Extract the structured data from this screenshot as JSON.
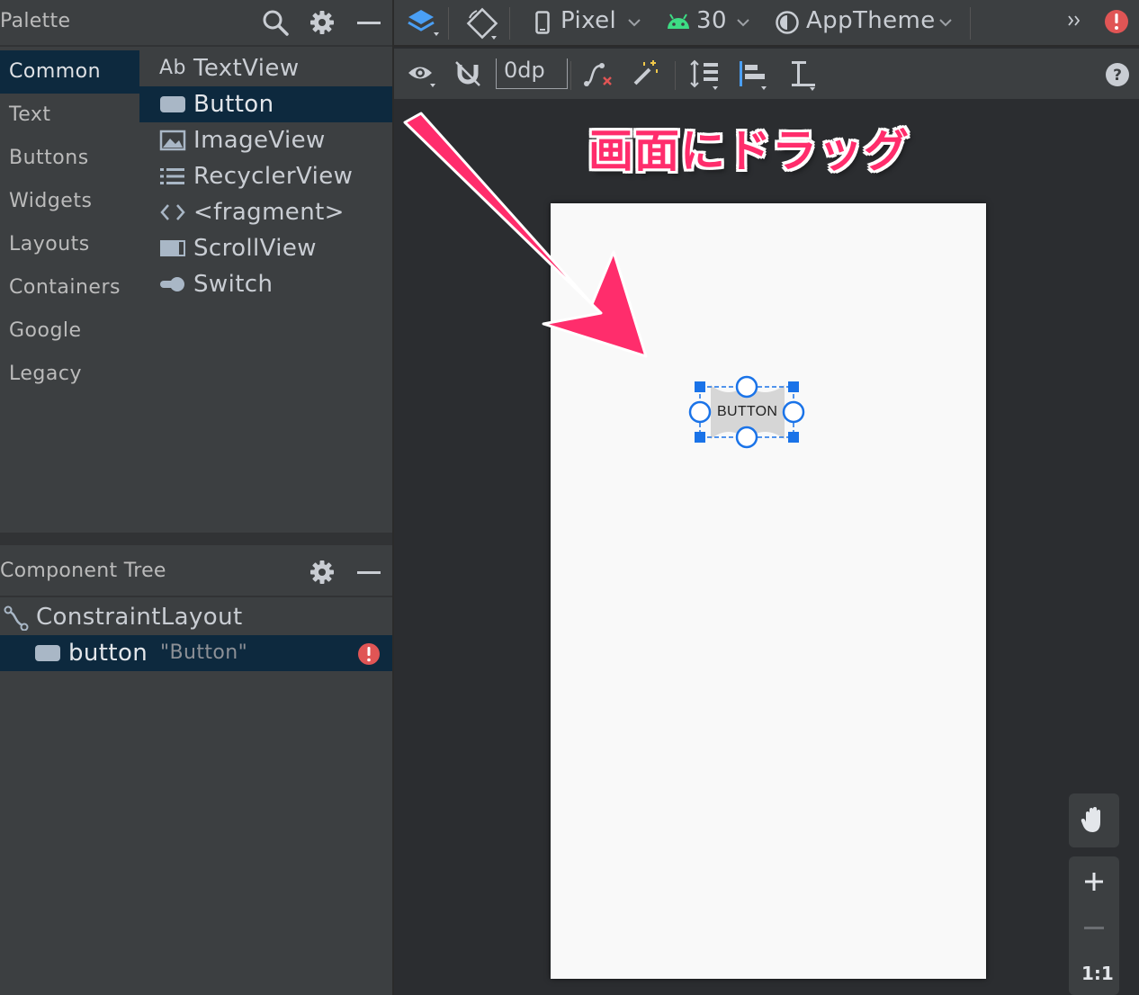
{
  "palette": {
    "title": "Palette",
    "categories": [
      "Common",
      "Text",
      "Buttons",
      "Widgets",
      "Layouts",
      "Containers",
      "Google",
      "Legacy"
    ],
    "selected_category": "Common",
    "items": [
      {
        "label": "TextView",
        "icon": "textview-icon"
      },
      {
        "label": "Button",
        "icon": "button-widget-icon"
      },
      {
        "label": "ImageView",
        "icon": "image-icon"
      },
      {
        "label": "RecyclerView",
        "icon": "list-icon"
      },
      {
        "label": "<fragment>",
        "icon": "code-brackets-icon"
      },
      {
        "label": "ScrollView",
        "icon": "scrollview-icon"
      },
      {
        "label": "Switch",
        "icon": "switch-icon"
      }
    ],
    "textview_icon_text": "Ab",
    "selected_item": "Button"
  },
  "component_tree": {
    "title": "Component Tree",
    "root": "ConstraintLayout",
    "child": {
      "id": "button",
      "text": "\"Button\"",
      "has_error": true
    }
  },
  "toolbar": {
    "device": "Pixel",
    "api_level": "30",
    "theme": "AppTheme",
    "margin": "0dp"
  },
  "canvas": {
    "annotation": "画面にドラッグ",
    "button_label": "BUTTON",
    "zoom_reset": "1:1"
  },
  "colors": {
    "accent_pink": "#ff2d6c",
    "selection_blue": "#0d293e",
    "handle_blue": "#1a73e8",
    "error_red": "#e05555",
    "android_green": "#3ddc84"
  }
}
